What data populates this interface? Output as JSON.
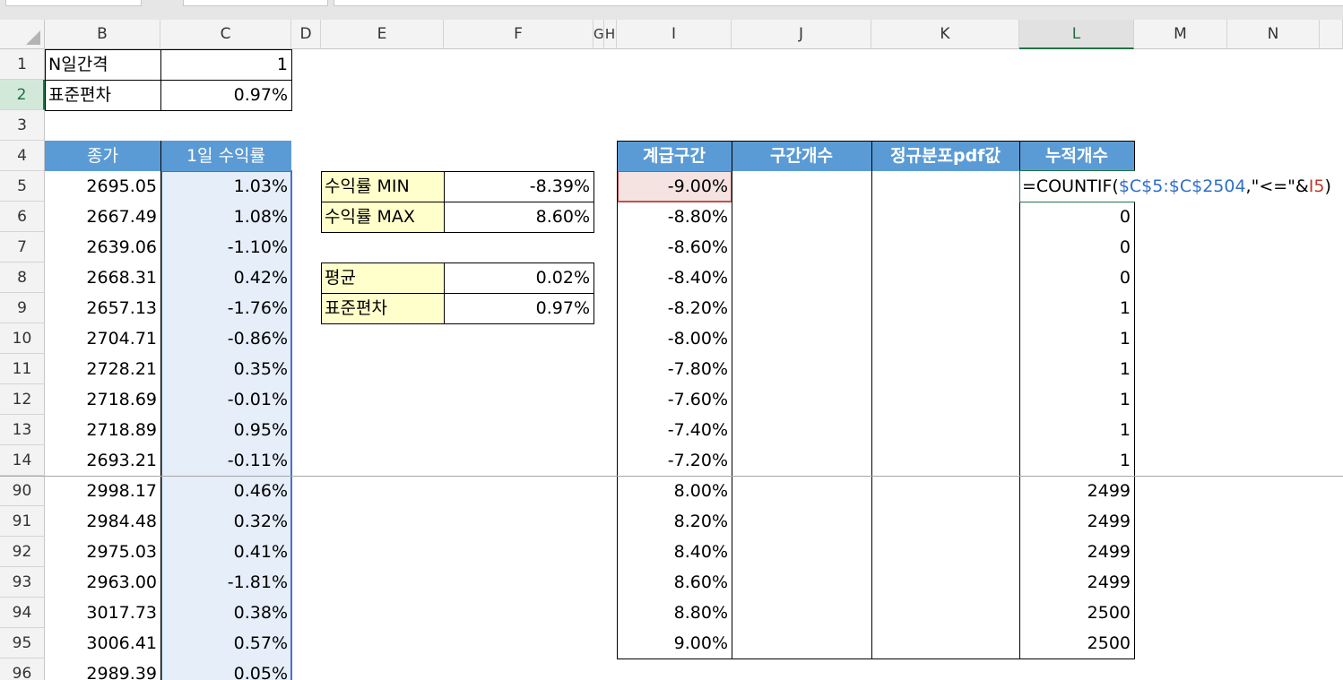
{
  "columns": [
    "B",
    "C",
    "D",
    "E",
    "F",
    "G",
    "H",
    "I",
    "J",
    "K",
    "L",
    "M",
    "N"
  ],
  "selected_column": "L",
  "rows": [
    "1",
    "2",
    "3",
    "4",
    "5",
    "6",
    "7",
    "8",
    "9",
    "10",
    "11",
    "12",
    "13",
    "14",
    "90",
    "91",
    "92",
    "93",
    "94",
    "95",
    "96"
  ],
  "selected_row": "2",
  "params": {
    "n_label": "N일간격",
    "n_value": "1",
    "std_label": "표준편차",
    "std_value": "0.97%"
  },
  "price_table": {
    "headers": [
      "종가",
      "1일 수익률"
    ],
    "rows": [
      [
        "2695.05",
        "1.03%"
      ],
      [
        "2667.49",
        "1.08%"
      ],
      [
        "2639.06",
        "-1.10%"
      ],
      [
        "2668.31",
        "0.42%"
      ],
      [
        "2657.13",
        "-1.76%"
      ],
      [
        "2704.71",
        "-0.86%"
      ],
      [
        "2728.21",
        "0.35%"
      ],
      [
        "2718.69",
        "-0.01%"
      ],
      [
        "2718.89",
        "0.95%"
      ],
      [
        "2693.21",
        "-0.11%"
      ],
      [
        "2998.17",
        "0.46%"
      ],
      [
        "2984.48",
        "0.32%"
      ],
      [
        "2975.03",
        "0.41%"
      ],
      [
        "2963.00",
        "-1.81%"
      ],
      [
        "3017.73",
        "0.38%"
      ],
      [
        "3006.41",
        "0.57%"
      ],
      [
        "2989.39",
        "0.05%"
      ]
    ]
  },
  "stats_minmax": [
    {
      "label": "수익률 MIN",
      "value": "-8.39%"
    },
    {
      "label": "수익률 MAX",
      "value": "8.60%"
    }
  ],
  "stats_meanstd": [
    {
      "label": "평균",
      "value": "0.02%"
    },
    {
      "label": "표준편차",
      "value": "0.97%"
    }
  ],
  "dist_table": {
    "headers": [
      "계급구간",
      "구간개수",
      "정규분포pdf값",
      "누적개수"
    ],
    "bins": [
      "-9.00%",
      "-8.80%",
      "-8.60%",
      "-8.40%",
      "-8.20%",
      "-8.00%",
      "-7.80%",
      "-7.60%",
      "-7.40%",
      "-7.20%",
      "8.00%",
      "8.20%",
      "8.40%",
      "8.60%",
      "8.80%",
      "9.00%"
    ],
    "cumulative": [
      "",
      "0",
      "0",
      "0",
      "1",
      "1",
      "1",
      "1",
      "1",
      "1",
      "2499",
      "2499",
      "2499",
      "2499",
      "2500",
      "2500"
    ]
  },
  "formula": {
    "prefix": "=COUNTIF(",
    "range": "$C$5:$C$2504",
    "middle": ",\"<=\"&",
    "ref": "I5",
    "suffix": ")"
  }
}
